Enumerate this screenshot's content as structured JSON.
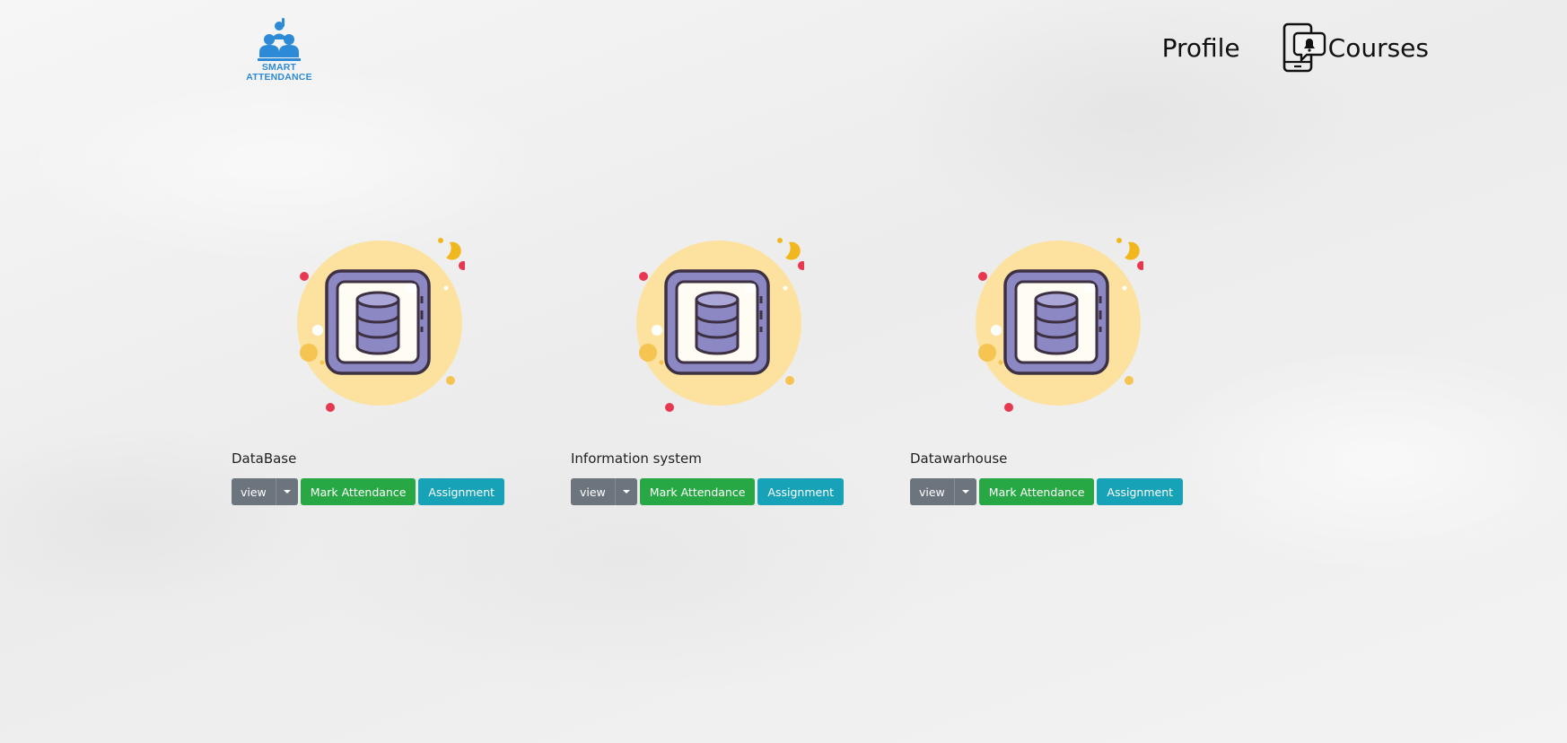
{
  "brand": {
    "logo_line1": "SMART",
    "logo_line2": "ATTENDANCE",
    "logo_color": "#2c8ad6"
  },
  "nav": {
    "profile_label": "Profile",
    "courses_label": "Courses",
    "courses_icon": "mobile-notification-icon"
  },
  "courses": [
    {
      "title": "DataBase",
      "view_label": "view",
      "mark_label": "Mark Attendance",
      "assignment_label": "Assignment",
      "icon": "database-icon"
    },
    {
      "title": "Information system",
      "view_label": "view",
      "mark_label": "Mark Attendance",
      "assignment_label": "Assignment",
      "icon": "database-icon"
    },
    {
      "title": "Datawarhouse",
      "view_label": "view",
      "mark_label": "Mark Attendance",
      "assignment_label": "Assignment",
      "icon": "database-icon"
    }
  ],
  "colors": {
    "view_button": "#6c757d",
    "mark_button": "#28a745",
    "assignment_button": "#17a2b8",
    "illustration_circle": "#fde19e",
    "database_purple": "#8c88c4",
    "dot_red": "#e8384f",
    "dot_yellow": "#f5c451"
  }
}
